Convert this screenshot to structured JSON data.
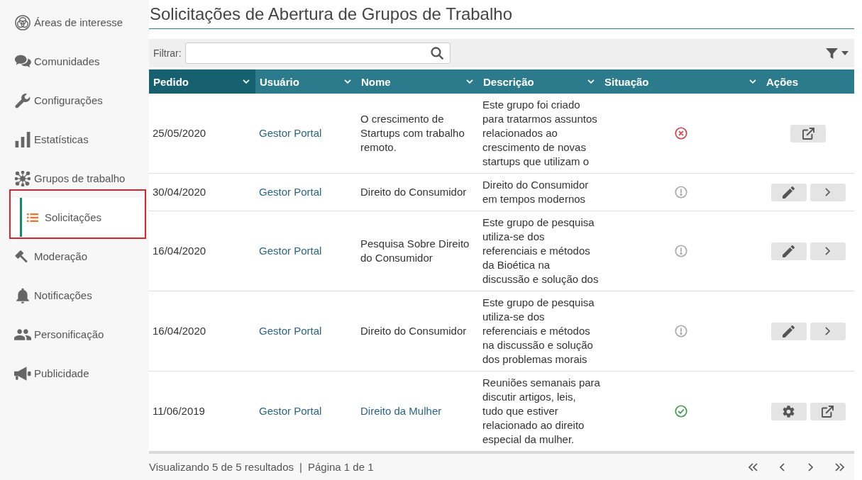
{
  "sidebar": {
    "items": [
      {
        "label": "Áreas de interesse",
        "selected": false,
        "outlined": false
      },
      {
        "label": "Comunidades",
        "selected": false,
        "outlined": false
      },
      {
        "label": "Configurações",
        "selected": false,
        "outlined": false
      },
      {
        "label": "Estatísticas",
        "selected": false,
        "outlined": false
      },
      {
        "label": "Grupos de trabalho",
        "selected": false,
        "outlined": false,
        "children": [
          {
            "label": "Solicitações",
            "selected": true,
            "outlined": true
          }
        ]
      },
      {
        "label": "Moderação",
        "selected": false,
        "outlined": false
      },
      {
        "label": "Notificações",
        "selected": false,
        "outlined": false
      },
      {
        "label": "Personificação",
        "selected": false,
        "outlined": false
      },
      {
        "label": "Publicidade",
        "selected": false,
        "outlined": false
      }
    ]
  },
  "page": {
    "title": "Solicitações de Abertura de Grupos de Trabalho"
  },
  "filter": {
    "label": "Filtrar:"
  },
  "table": {
    "columns": [
      {
        "label": "Pedido",
        "sorted": true,
        "menu": true
      },
      {
        "label": "Usuário",
        "sorted": false,
        "menu": true
      },
      {
        "label": "Nome",
        "sorted": false,
        "menu": true
      },
      {
        "label": "Descrição",
        "sorted": false,
        "menu": true
      },
      {
        "label": "Situação",
        "sorted": false,
        "menu": true
      },
      {
        "label": "Ações",
        "sorted": false,
        "menu": false
      }
    ],
    "rows": [
      {
        "date": "25/05/2020",
        "user": "Gestor Portal",
        "name": "O crescimento de Startups com trabalho remoto.",
        "name_is_link": false,
        "description": "Este grupo foi criado\npara tratarmos assuntos\nrelacionados ao\ncrescimento de novas\nstartups que utilizam o",
        "status": {
          "kind": "rejected",
          "color": "#d43f4a"
        },
        "actions": [
          {
            "kind": "open"
          }
        ]
      },
      {
        "date": "30/04/2020",
        "user": "Gestor Portal",
        "name": "Direito do Consumidor",
        "name_is_link": false,
        "description": "Direito do Consumidor\nem tempos modernos",
        "status": {
          "kind": "pending",
          "color": "#a9a9a9"
        },
        "actions": [
          {
            "kind": "edit"
          },
          {
            "kind": "next"
          }
        ]
      },
      {
        "date": "16/04/2020",
        "user": "Gestor Portal",
        "name": "Pesquisa Sobre Direito do Consumidor",
        "name_is_link": false,
        "description": "Este grupo de pesquisa\nutiliza-se dos\nreferenciais e métodos\nda Bioética na\ndiscussão e solução dos",
        "status": {
          "kind": "pending",
          "color": "#a9a9a9"
        },
        "actions": [
          {
            "kind": "edit"
          },
          {
            "kind": "next"
          }
        ]
      },
      {
        "date": "16/04/2020",
        "user": "Gestor Portal",
        "name": "Direito do Consumidor",
        "name_is_link": false,
        "description": "Este grupo de pesquisa\nutiliza-se dos\nreferenciais e métodos\nna discussão e solução\ndos problemas morais",
        "status": {
          "kind": "pending",
          "color": "#a9a9a9"
        },
        "actions": [
          {
            "kind": "edit"
          },
          {
            "kind": "next"
          }
        ]
      },
      {
        "date": "11/06/2019",
        "user": "Gestor Portal",
        "name": "Direito da Mulher",
        "name_is_link": true,
        "description": "Reuniões semanais para\ndiscutir artigos, leis,\ntudo que estiver\nrelacionado ao direito\nespecial da mulher.",
        "status": {
          "kind": "approved",
          "color": "#3d9a4c"
        },
        "actions": [
          {
            "kind": "settings"
          },
          {
            "kind": "open"
          }
        ]
      }
    ]
  },
  "footer": {
    "summary": "Visualizando 5 de 5 resultados",
    "separator": "|",
    "page": "Página 1 de 1"
  }
}
